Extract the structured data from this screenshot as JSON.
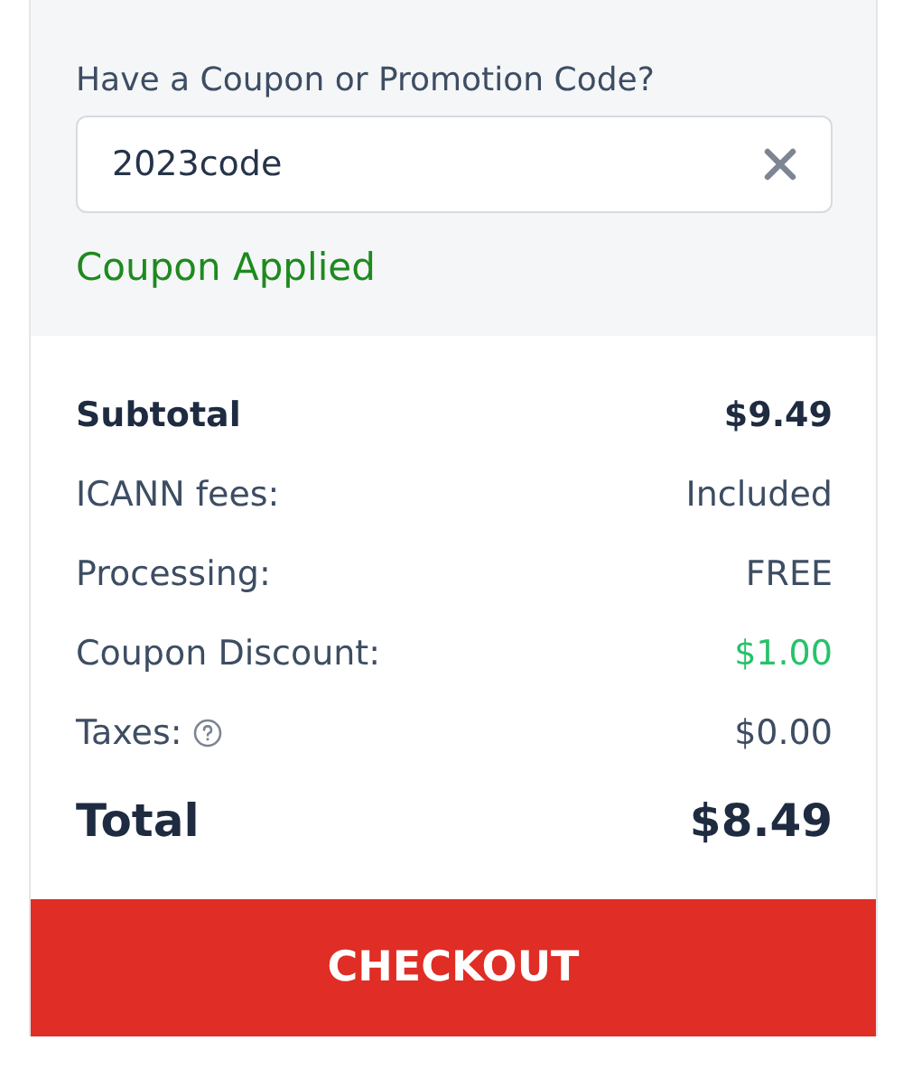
{
  "coupon": {
    "title": "Have a Coupon or Promotion Code?",
    "value": "2023code",
    "status": "Coupon Applied"
  },
  "summary": [
    {
      "kind": "subtotal",
      "label": "Subtotal",
      "value": "$9.49"
    },
    {
      "kind": "line",
      "label": "ICANN fees:",
      "value": "Included"
    },
    {
      "kind": "line",
      "label": "Processing:",
      "value": "FREE"
    },
    {
      "kind": "discount",
      "label": "Coupon Discount:",
      "value": "$1.00"
    },
    {
      "kind": "help",
      "label": "Taxes:",
      "value": "$0.00"
    },
    {
      "kind": "total",
      "label": "Total",
      "value": "$8.49"
    }
  ],
  "checkout": {
    "label": "CHECKOUT"
  }
}
